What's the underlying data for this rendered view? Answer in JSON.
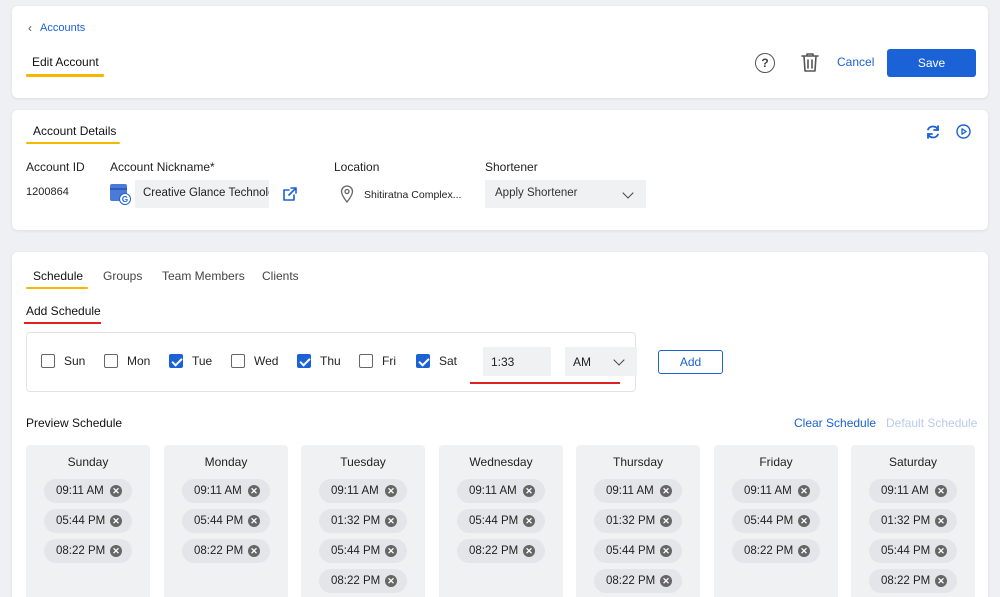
{
  "header": {
    "breadcrumb": "Accounts",
    "title": "Edit Account",
    "help_symbol": "?",
    "cancel_label": "Cancel",
    "save_label": "Save",
    "accent_color": "#1a62d6",
    "underline_color": "#f5b800"
  },
  "account_details": {
    "section_title": "Account Details",
    "account_id_label": "Account ID",
    "account_id": "1200864",
    "nickname_label": "Account Nickname*",
    "nickname_value": "Creative Glance Technologies",
    "location_label": "Location",
    "location_value": "Shitiratna Complex...",
    "shortener_label": "Shortener",
    "shortener_value": "Apply Shortener"
  },
  "tabs": [
    "Schedule",
    "Groups",
    "Team Members",
    "Clients"
  ],
  "schedule": {
    "add_title": "Add Schedule",
    "days": [
      {
        "label": "Sun",
        "checked": false
      },
      {
        "label": "Mon",
        "checked": false
      },
      {
        "label": "Tue",
        "checked": true
      },
      {
        "label": "Wed",
        "checked": false
      },
      {
        "label": "Thu",
        "checked": true
      },
      {
        "label": "Fri",
        "checked": false
      },
      {
        "label": "Sat",
        "checked": true
      }
    ],
    "time_value": "1:33",
    "ampm_value": "AM",
    "add_label": "Add"
  },
  "preview": {
    "title": "Preview Schedule",
    "clear_label": "Clear Schedule",
    "default_label": "Default Schedule",
    "remove_symbol": "✕",
    "columns": [
      {
        "day": "Sunday",
        "times": [
          "09:11 AM",
          "05:44 PM",
          "08:22 PM"
        ]
      },
      {
        "day": "Monday",
        "times": [
          "09:11 AM",
          "05:44 PM",
          "08:22 PM"
        ]
      },
      {
        "day": "Tuesday",
        "times": [
          "09:11 AM",
          "01:32 PM",
          "05:44 PM",
          "08:22 PM"
        ]
      },
      {
        "day": "Wednesday",
        "times": [
          "09:11 AM",
          "05:44 PM",
          "08:22 PM"
        ]
      },
      {
        "day": "Thursday",
        "times": [
          "09:11 AM",
          "01:32 PM",
          "05:44 PM",
          "08:22 PM"
        ]
      },
      {
        "day": "Friday",
        "times": [
          "09:11 AM",
          "05:44 PM",
          "08:22 PM"
        ]
      },
      {
        "day": "Saturday",
        "times": [
          "09:11 AM",
          "01:32 PM",
          "05:44 PM",
          "08:22 PM"
        ]
      }
    ]
  }
}
